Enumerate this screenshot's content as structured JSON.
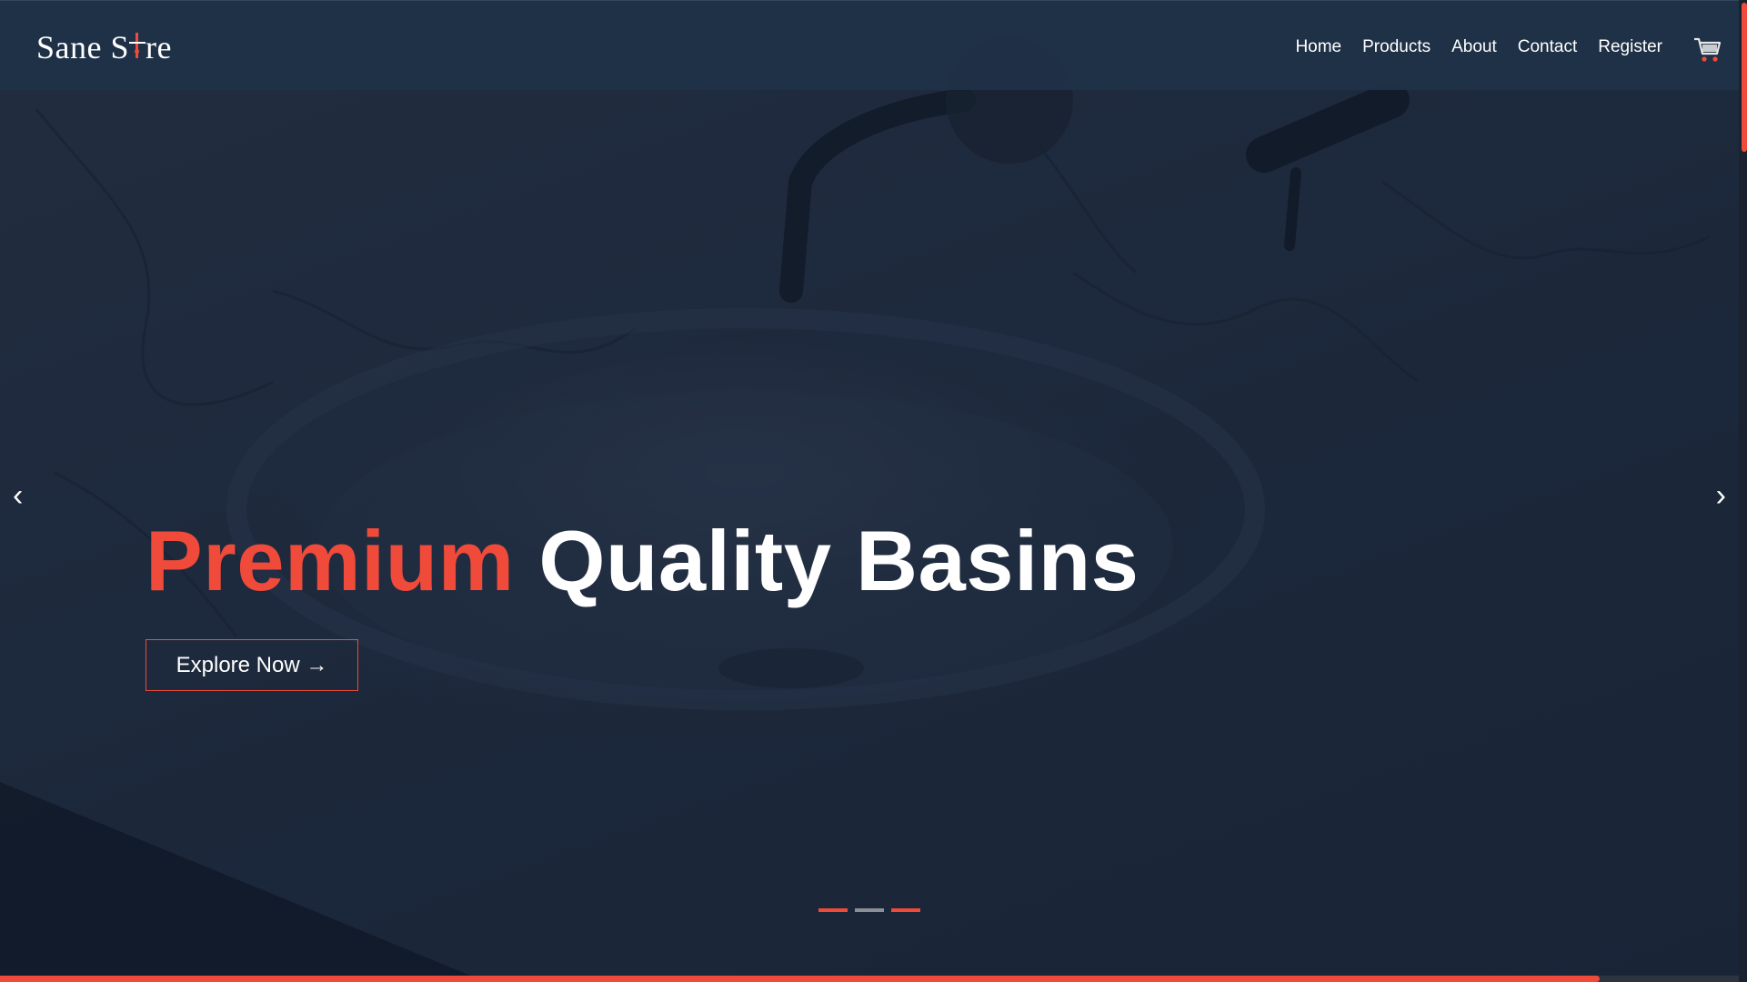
{
  "header": {
    "logo_text_prefix": "Sane S",
    "logo_text_suffix": "re",
    "nav": [
      {
        "label": "Home"
      },
      {
        "label": "Products"
      },
      {
        "label": "About"
      },
      {
        "label": "Contact"
      },
      {
        "label": "Register"
      }
    ],
    "cart_icon": "shopping-cart-icon"
  },
  "hero": {
    "title_accent": "Premium",
    "title_rest": "Quality Basins",
    "cta_label": "Explore Now →",
    "prev_arrow": "‹",
    "next_arrow": "›",
    "slides_count": 3,
    "active_indicators": [
      0,
      2
    ]
  },
  "page_progress": 0.92,
  "colors": {
    "accent": "#ef4a3a",
    "header_bg": "#1f3248",
    "hero_bg": "#243044",
    "indicator_inactive": "#8b8f96"
  }
}
